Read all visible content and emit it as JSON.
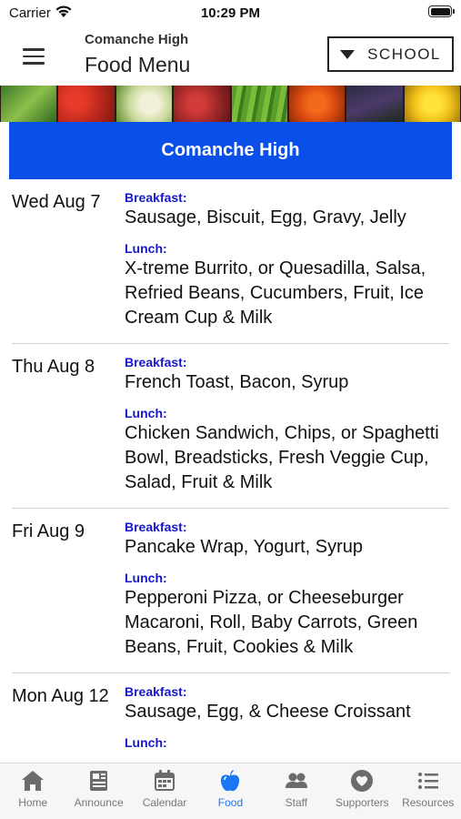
{
  "status_bar": {
    "carrier": "Carrier",
    "time": "10:29 PM"
  },
  "header": {
    "subtitle": "Comanche High",
    "title": "Food Menu",
    "school_button_label": "SCHOOL"
  },
  "school_heading": "Comanche High",
  "menu": [
    {
      "date": "Wed Aug 7",
      "breakfast_label": "Breakfast:",
      "breakfast": "Sausage, Biscuit, Egg, Gravy, Jelly",
      "lunch_label": "Lunch:",
      "lunch": "X-treme Burrito, or Quesadilla, Salsa, Refried Beans, Cucumbers, Fruit, Ice Cream Cup & Milk"
    },
    {
      "date": "Thu Aug 8",
      "breakfast_label": "Breakfast:",
      "breakfast": "French Toast, Bacon, Syrup",
      "lunch_label": "Lunch:",
      "lunch": "Chicken Sandwich, Chips, or Spaghetti Bowl, Breadsticks, Fresh Veggie Cup, Salad, Fruit & Milk"
    },
    {
      "date": "Fri Aug 9",
      "breakfast_label": "Breakfast:",
      "breakfast": "Pancake Wrap, Yogurt, Syrup",
      "lunch_label": "Lunch:",
      "lunch": "Pepperoni Pizza, or Cheeseburger Macaroni, Roll, Baby Carrots, Green Beans, Fruit, Cookies & Milk"
    },
    {
      "date": "Mon Aug 12",
      "breakfast_label": "Breakfast:",
      "breakfast": "Sausage, Egg, & Cheese Croissant",
      "lunch_label": "Lunch:",
      "lunch": ""
    }
  ],
  "tabs": [
    {
      "label": "Home",
      "icon": "home-icon"
    },
    {
      "label": "Announce",
      "icon": "newspaper-icon"
    },
    {
      "label": "Calendar",
      "icon": "calendar-icon"
    },
    {
      "label": "Food",
      "icon": "apple-icon",
      "active": true
    },
    {
      "label": "Staff",
      "icon": "people-icon"
    },
    {
      "label": "Supporters",
      "icon": "heart-badge-icon"
    },
    {
      "label": "Resources",
      "icon": "list-icon"
    }
  ],
  "colors": {
    "heading_blue": "#0a4fe8",
    "meal_label_blue": "#1418c8",
    "active_tab": "#1976f5",
    "inactive_tab": "#777777"
  }
}
